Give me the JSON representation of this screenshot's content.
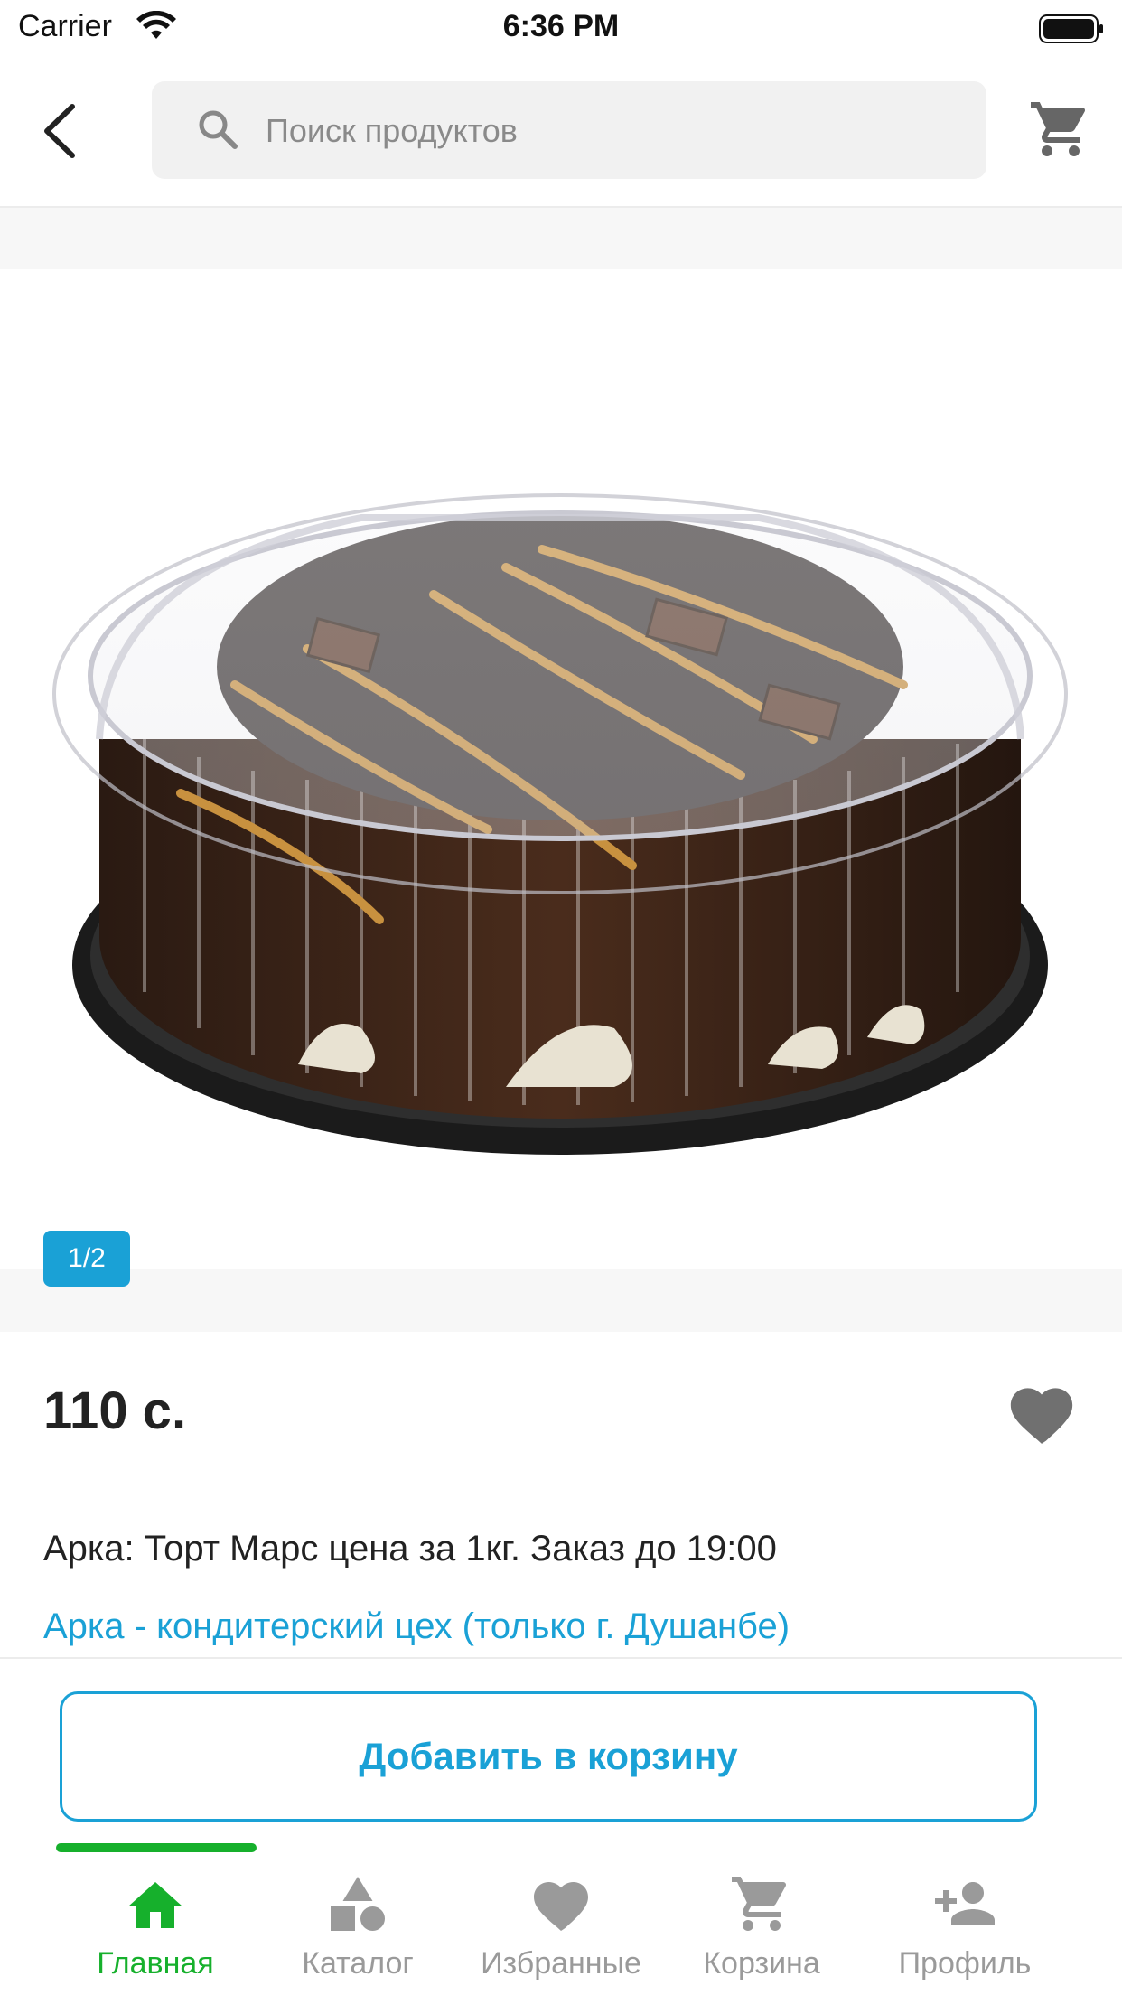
{
  "status_bar": {
    "carrier": "Carrier",
    "time": "6:36 PM"
  },
  "header": {
    "search_placeholder": "Поиск продуктов",
    "icons": [
      "back-arrow-icon",
      "search-icon",
      "cart-icon"
    ]
  },
  "gallery": {
    "page_indicator": "1/2",
    "image": "cake-in-plastic-box"
  },
  "product": {
    "price": "110 с.",
    "title": "Арка: Торт Марс цена за 1кг. Заказ до 19:00",
    "vendor": "Арка - кондитерский цех (только г. Душанбе)"
  },
  "actions": {
    "add_to_cart": "Добавить в корзину"
  },
  "tabs": [
    {
      "label": "Главная",
      "icon": "home-icon",
      "active": true
    },
    {
      "label": "Каталог",
      "icon": "shapes-icon",
      "active": false
    },
    {
      "label": "Избранные",
      "icon": "heart-icon",
      "active": false
    },
    {
      "label": "Корзина",
      "icon": "cart-icon",
      "active": false
    },
    {
      "label": "Профиль",
      "icon": "add-person-icon",
      "active": false
    }
  ],
  "colors": {
    "accent": "#1aa1d6",
    "active_tab": "#16b02c",
    "inactive_icon": "#9a9a9a"
  }
}
